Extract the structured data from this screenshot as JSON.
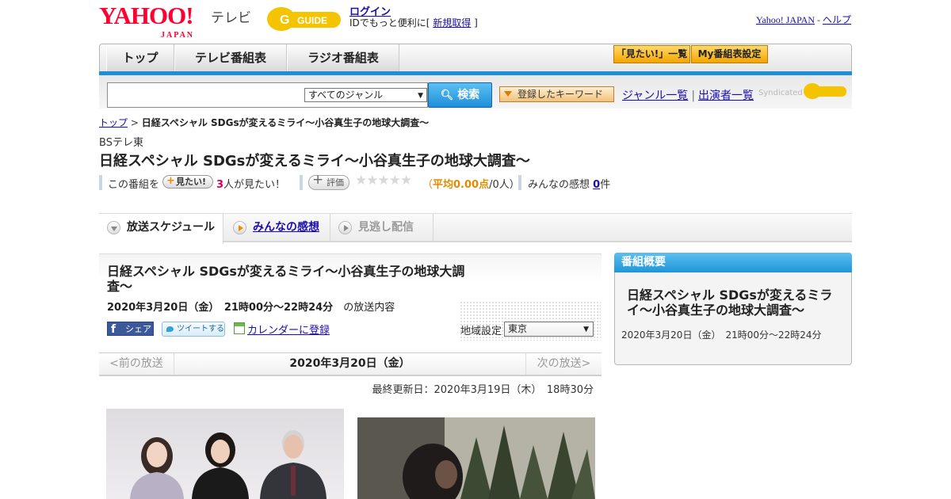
{
  "header": {
    "yahoo_logo": "YAHOO!",
    "yahoo_sub": "JAPAN",
    "tv_label": "テレビ",
    "gguide_logo": "G-GUIDE",
    "login": "ログイン",
    "id_prefix": "IDでもっと便利に[ ",
    "register": "新規取得",
    "id_suffix": " ]",
    "yahoo_japan_link": "Yahoo! JAPAN",
    "sep": " - ",
    "help_link": "ヘルプ"
  },
  "nav": {
    "tabs": [
      "トップ",
      "テレビ番組表",
      "ラジオ番組表"
    ],
    "mitai_list": "「見たい!」一覧",
    "my_schedule": "My番組表設定"
  },
  "search": {
    "genre": "すべてのジャンル",
    "button": "検索",
    "keyword_button": "登録したキーワード",
    "genre_list": "ジャンル一覧",
    "divider": "|",
    "performer_list": "出演者一覧",
    "syndicated": "Syndicated"
  },
  "breadcrumb": {
    "top": "トップ",
    "sep": " > ",
    "current": "日経スペシャル SDGsが変えるミライ～小谷真生子の地球大調査～"
  },
  "program": {
    "channel": "BSテレ東",
    "title": "日経スペシャル SDGsが変えるミライ～小谷真生子の地球大調査～",
    "this_program": "この番組を",
    "mitai_btn": "見たい!",
    "mitai_count": "3",
    "mitai_suffix": "人が見たい！",
    "hyoka_btn": "評価",
    "stars": "★★★★★",
    "avg_open": "（",
    "avg_text": "平均0.00点",
    "avg_count": "/0人",
    "avg_close": "）",
    "impressions_label": "みんなの感想",
    "impressions_count": "0",
    "impressions_suffix": "件",
    "rating": 0
  },
  "tabs": {
    "schedule": "放送スケジュール",
    "impressions": "みんなの感想",
    "missed": "見逃し配信"
  },
  "broadcast": {
    "title": "日経スペシャル SDGsが変えるミライ～小谷真生子の地球大調査～",
    "date": "2020年3月20日（金）　21時00分～22時24分",
    "date_suffix": "の放送内容",
    "fb_share": "シェア",
    "tweet": "ツイートする",
    "calendar": "カレンダーに登録",
    "region_label": "地域設定",
    "region_value": "東京",
    "prev": "<前の放送",
    "current_date": "2020年3月20日（金）",
    "next": "次の放送>",
    "updated": "最終更新日：2020年3月19日（木）　18時30分"
  },
  "summary": {
    "heading": "番組概要",
    "title": "日経スペシャル SDGsが変えるミライ～小谷真生子の地球大調査～",
    "date": "2020年3月20日（金）　21時00分～22時24分"
  },
  "colors": {
    "accent_blue": "#1c8fd8",
    "yahoo_red": "#ff0033",
    "guide_yellow": "#f5c400"
  }
}
